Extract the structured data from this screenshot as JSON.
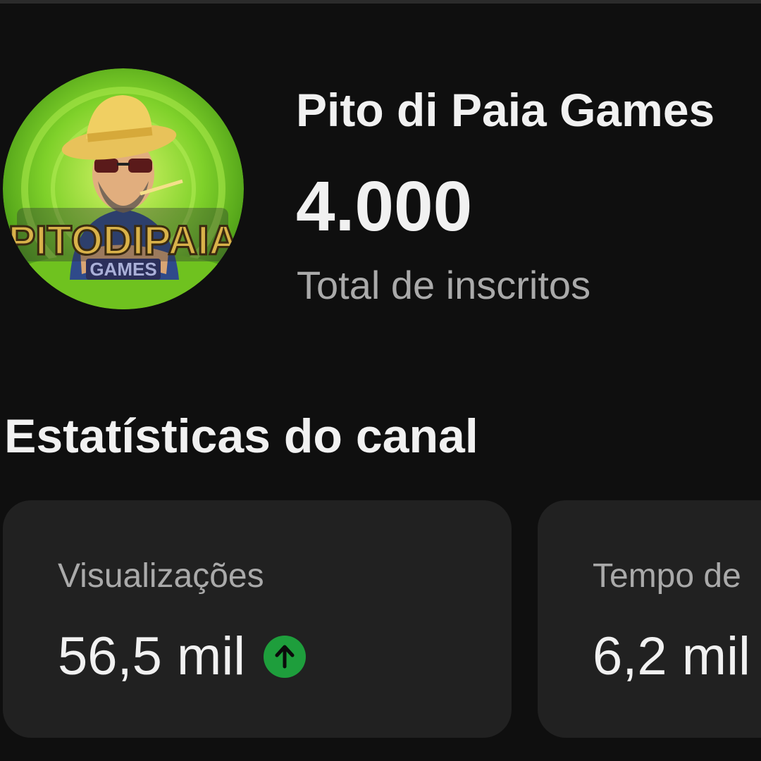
{
  "channel": {
    "name": "Pito di Paia Games",
    "subscriber_count": "4.000",
    "subscriber_label": "Total de inscritos",
    "avatar": {
      "icon": "channel-avatar",
      "logo_text": "PITODIPAIA",
      "logo_subtext": "GAMES"
    }
  },
  "stats": {
    "title": "Estatísticas do canal",
    "cards": [
      {
        "label": "Visualizações",
        "value": "56,5 mil",
        "trend": "up",
        "trend_icon": "arrow-up-icon",
        "trend_color": "#1e9e3c"
      },
      {
        "label": "Tempo de",
        "value": "6,2 mil"
      }
    ]
  },
  "colors": {
    "background": "#0f0f0f",
    "card": "#212121",
    "primary_text": "#f1f1f1",
    "secondary_text": "#aaaaaa"
  }
}
